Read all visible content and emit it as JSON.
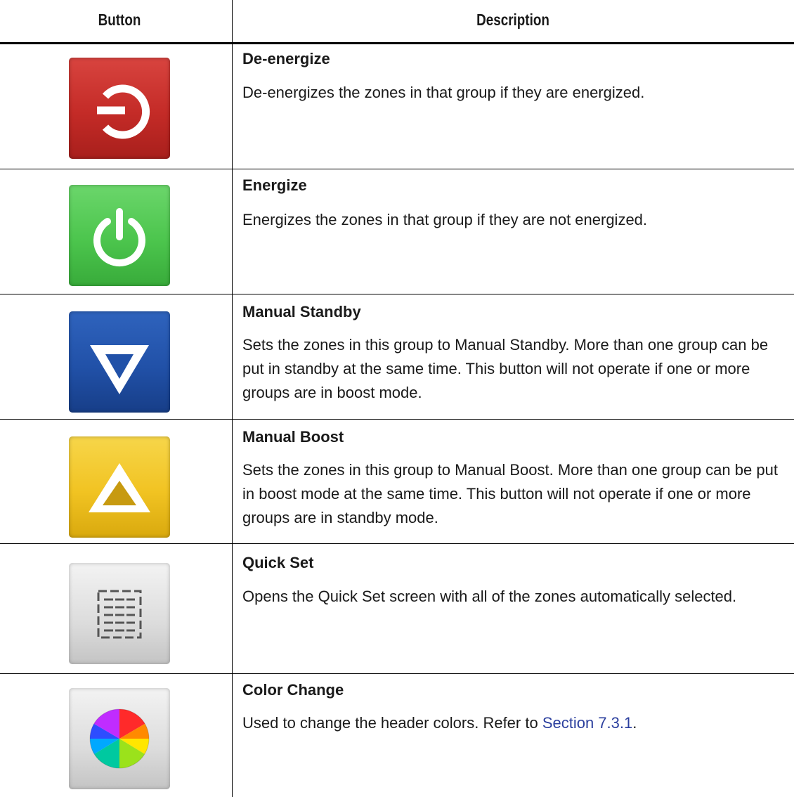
{
  "table": {
    "headers": {
      "button": "Button",
      "description": "Description"
    },
    "rows": [
      {
        "title": "De-energize",
        "description": "De-energizes the zones in that group if they are energized.",
        "icon": "power-off-icon",
        "color": "#c42b27"
      },
      {
        "title": "Energize",
        "description": "Energizes the zones in that group if they are not energized.",
        "icon": "power-on-icon",
        "color": "#4cc54d"
      },
      {
        "title": "Manual Standby",
        "description": "Sets the zones in this group to Manual Standby. More than one group can be put in standby at the same time. This button will not operate if one or more groups are in boost mode.",
        "icon": "triangle-down-icon",
        "color": "#2151a8"
      },
      {
        "title": "Manual Boost",
        "description": "Sets the zones in this group to Manual Boost. More than one group can be put in boost mode at the same time. This button will not operate if one or more groups are in standby mode.",
        "icon": "triangle-up-icon",
        "color": "#f1c322"
      },
      {
        "title": "Quick Set",
        "description": "Opens the Quick Set screen with all of the zones automatically selected.",
        "icon": "quick-set-grid-icon",
        "color": "#dcdcdc"
      },
      {
        "title": "Color Change",
        "description_prefix": "Used to change the header colors. Refer to ",
        "link_text": "Section 7.3.1",
        "description_suffix": ".",
        "icon": "color-wheel-icon",
        "color": "#dcdcdc"
      }
    ]
  }
}
